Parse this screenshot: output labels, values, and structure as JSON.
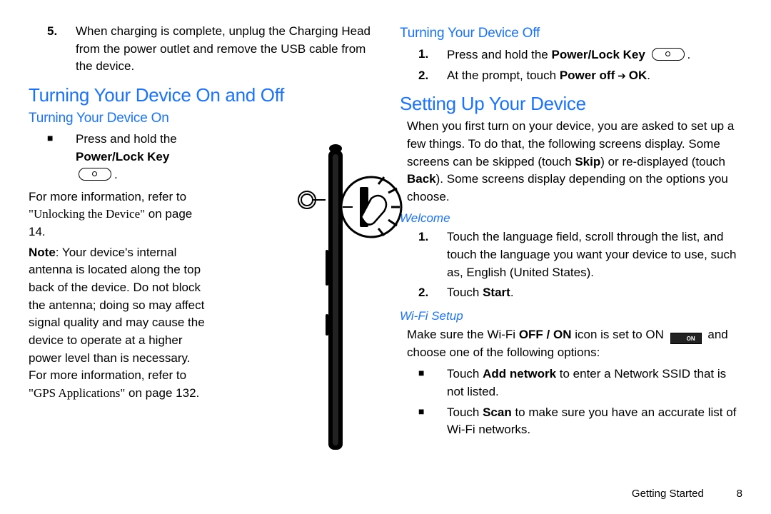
{
  "left": {
    "step5_num": "5.",
    "step5_text_a": "When charging is complete, unplug the Charging Head from the power outlet and remove the USB cable from the device.",
    "h_major": "Turning Your Device On and Off",
    "h_sub_on": "Turning Your Device On",
    "press_hold": "Press and hold the",
    "power_lock": "Power/Lock Key",
    "for_more_a": "For more information, refer to ",
    "unlock_ref": "\"Unlocking the Device\"",
    "on_page14": " on page 14.",
    "note_label": "Note",
    "note_body": ": Your device's internal antenna is located along the top back of the device. Do not block the antenna; doing so may affect signal quality and may cause the device to operate at a higher power level than is necessary. For more information, refer to ",
    "gps_ref": "\"GPS Applications\"",
    "on_page132": " on page 132."
  },
  "right": {
    "h_sub_off": "Turning Your Device Off",
    "off1_num": "1.",
    "off1_a": "Press and hold the ",
    "off1_b": "Power/Lock Key",
    "off1_c": ".",
    "off2_num": "2.",
    "off2_a": "At the prompt, touch ",
    "off2_b": "Power off",
    "off2_arrow": " ➔ ",
    "off2_c": "OK",
    "off2_d": ".",
    "h_setup": "Setting Up Your Device",
    "setup_intro_a": "When you first turn on your device, you are asked to set up a few things. To do that, the following screens display. Some screens can be skipped (touch ",
    "skip": "Skip",
    "setup_intro_b": ") or re-displayed (touch ",
    "back": "Back",
    "setup_intro_c": "). Some screens display depending on the options you choose.",
    "h_welcome": "Welcome",
    "w1_num": "1.",
    "w1_text": "Touch the language field, scroll through the list, and touch the language you want your device to use, such as, English (United States).",
    "w2_num": "2.",
    "w2_a": "Touch ",
    "w2_b": "Start",
    "w2_c": ".",
    "h_wifi": "Wi-Fi Setup",
    "wifi_a": "Make sure the Wi-Fi ",
    "wifi_offon": "OFF / ON",
    "wifi_b": " icon is set to ON ",
    "on_label": "ON",
    "wifi_c": " and choose one of the following options:",
    "wb1_a": "Touch ",
    "wb1_b": "Add network",
    "wb1_c": " to enter a Network SSID that is not listed.",
    "wb2_a": "Touch ",
    "wb2_b": "Scan",
    "wb2_c": " to make sure you have an accurate list of Wi-Fi networks."
  },
  "footer": {
    "section": "Getting Started",
    "page": "8"
  }
}
